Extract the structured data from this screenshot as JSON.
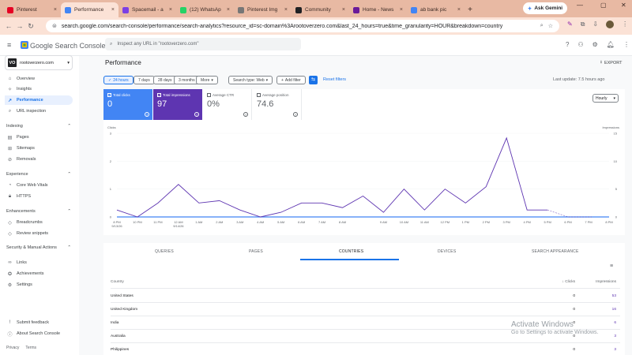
{
  "browser": {
    "tabs": [
      {
        "label": "Pinterest",
        "color": "#e60023"
      },
      {
        "label": "Performance",
        "color": "#4285f4"
      },
      {
        "label": "Spacemail - a",
        "color": "#7b3fe4"
      },
      {
        "label": "(12) WhatsAp",
        "color": "#25d366"
      },
      {
        "label": "Pinterest Img",
        "color": "#777777"
      },
      {
        "label": "Community",
        "color": "#202124"
      },
      {
        "label": "Home - News",
        "color": "#6a1b9a"
      },
      {
        "label": "ab bank pic",
        "color": "#4285f4"
      }
    ],
    "gemini_label": "Ask Gemini",
    "url": "search.google.com/search-console/performance/search-analytics?resource_id=sc-domain%3Arootoverzero.com&last_24_hours=true&time_granularity=HOUR&breakdown=country"
  },
  "app": {
    "name": "Google Search Console",
    "inspect_placeholder": "Inspect any URL in \"rootoverzero.com\"",
    "property": "rootoverzero.com",
    "property_logo": "VO"
  },
  "sidebar": {
    "top": [
      {
        "label": "Overview",
        "icon": "home-icon"
      },
      {
        "label": "Insights",
        "icon": "insights-icon"
      },
      {
        "label": "Performance",
        "icon": "trending-icon"
      },
      {
        "label": "URL inspection",
        "icon": "search-icon"
      }
    ],
    "indexing_title": "Indexing",
    "indexing": [
      "Pages",
      "Sitemaps",
      "Removals"
    ],
    "experience_title": "Experience",
    "experience": [
      "Core Web Vitals",
      "HTTPS"
    ],
    "enhancements_title": "Enhancements",
    "enhancements": [
      "Breadcrumbs",
      "Review snippets"
    ],
    "security_title": "Security & Manual Actions",
    "other": [
      "Links",
      "Achievements",
      "Settings"
    ],
    "bottom": [
      "Submit feedback",
      "About Search Console"
    ],
    "footer": [
      "Privacy",
      "Terms"
    ]
  },
  "main": {
    "title": "Performance",
    "export_label": "EXPORT",
    "date_chips": [
      "24 hours",
      "7 days",
      "28 days",
      "3 months",
      "More"
    ],
    "search_type": "Search type: Web",
    "add_filter": "Add filter",
    "reset_filters": "Reset filters",
    "last_update": "Last update: 7.5 hours ago",
    "cards": [
      {
        "label": "Total clicks",
        "value": "0"
      },
      {
        "label": "Total impressions",
        "value": "97"
      },
      {
        "label": "Average CTR",
        "value": "0%"
      },
      {
        "label": "Average position",
        "value": "74.6"
      }
    ],
    "granularity": "Hourly"
  },
  "chart_data": {
    "type": "line",
    "left_axis_label": "Clicks",
    "right_axis_label": "Impressions",
    "left_ticks": [
      "3",
      "2",
      "1",
      "0"
    ],
    "right_ticks": [
      "15",
      "10",
      "5",
      "0"
    ],
    "x_ticks": [
      "8 PM 9/13/26",
      "10 PM",
      "11 PM",
      "12 AM 9/14/26",
      "1 AM",
      "2 AM",
      "3 AM",
      "4 AM",
      "5 AM",
      "6 AM",
      "7 AM",
      "8 AM",
      "9 AM",
      "10 AM",
      "11 AM",
      "12 PM",
      "1 PM",
      "2 PM",
      "3 PM",
      "4 PM",
      "5 PM",
      "6 PM",
      "7 PM",
      "8 PM"
    ],
    "x": [
      "8 PM",
      "9 PM",
      "10 PM",
      "11 PM",
      "12 AM",
      "1 AM",
      "2 AM",
      "3 AM",
      "4 AM",
      "5 AM",
      "6 AM",
      "7 AM",
      "8 AM",
      "9 AM",
      "10 AM",
      "11 AM",
      "12 PM",
      "1 PM",
      "2 PM",
      "3 PM",
      "4 PM",
      "5 PM",
      "6 PM",
      "7 PM",
      "8 PM"
    ],
    "series": [
      {
        "name": "Clicks",
        "color": "#4285f4",
        "values": [
          0,
          0,
          0,
          0,
          0,
          0,
          0,
          0,
          0,
          0,
          0,
          0,
          0,
          0,
          0,
          0,
          0,
          0,
          0,
          0,
          0,
          0,
          0,
          0,
          0
        ]
      },
      {
        "name": "Impressions",
        "color": "#5e35b1",
        "values": [
          1.5,
          0,
          3,
          7,
          3,
          3.5,
          1.5,
          0,
          1,
          3,
          3,
          2,
          4.5,
          1,
          6,
          1.5,
          6,
          3,
          6.5,
          17,
          1.5,
          1.5,
          0,
          null,
          null
        ],
        "dashed_from_index": 21
      }
    ],
    "ylim_left": [
      0,
      3
    ],
    "ylim_right": [
      0,
      18
    ]
  },
  "table": {
    "tabs": [
      "QUERIES",
      "PAGES",
      "COUNTRIES",
      "DEVICES",
      "SEARCH APPEARANCE"
    ],
    "active_tab": "COUNTRIES",
    "columns": [
      "Country",
      "Clicks",
      "Impressions"
    ],
    "rows": [
      [
        "United States",
        "0",
        "53"
      ],
      [
        "United Kingdom",
        "0",
        "16"
      ],
      [
        "India",
        "0",
        "6"
      ],
      [
        "Australia",
        "0",
        "3"
      ],
      [
        "Philippines",
        "0",
        "3"
      ]
    ]
  },
  "watermark": {
    "line1": "Activate Windows",
    "line2": "Go to Settings to activate Windows."
  }
}
